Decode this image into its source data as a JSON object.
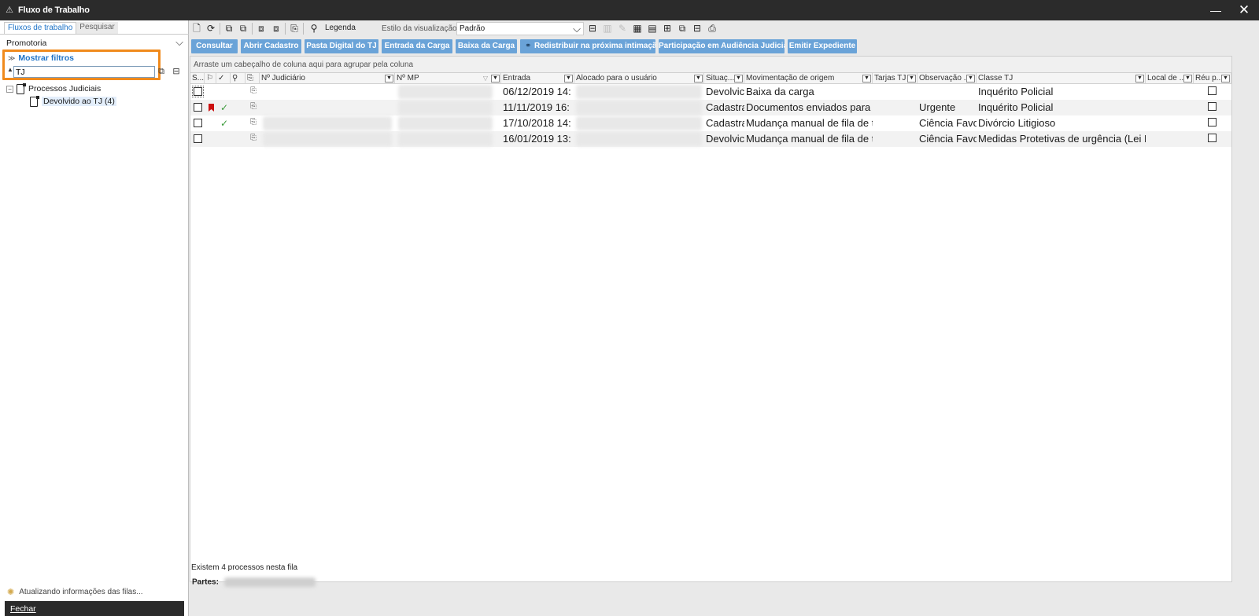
{
  "window": {
    "title": "Fluxo de Trabalho"
  },
  "left": {
    "tabs": [
      "Fluxos de trabalho",
      "Pesquisar"
    ],
    "workflow_select": "Promotoria",
    "show_filters": "Mostrar filtros",
    "filter_value": "TJ",
    "tree": {
      "root": "Processos Judiciais",
      "child": "Devolvido ao TJ (4)"
    },
    "status": "Atualizando informações das filas...",
    "close_button": "Fechar"
  },
  "toolbar": {
    "legend": "Legenda",
    "style_label": "Estilo da visualização",
    "style_value": "Padrão"
  },
  "actions": [
    "Consultar",
    "Abrir Cadastro",
    "Pasta Digital do TJ",
    "Entrada da Carga",
    "Baixa da Carga",
    "Redistribuir na próxima intimação",
    "Participação em Audiência Judicial",
    "Emitir Expediente"
  ],
  "grid": {
    "group_hint": "Arraste um cabeçalho de coluna aqui para agrupar pela coluna",
    "columns": [
      "S...",
      "Nº Judiciário",
      "Nº MP",
      "Entrada",
      "Alocado para o usuário",
      "Situaç...",
      "Movimentação de origem",
      "Tarjas TJ",
      "Observação ...",
      "Classe TJ",
      "Local de ...",
      "Réu p..."
    ],
    "rows": [
      {
        "entrada": "06/12/2019 14:",
        "situacao": "Devolvic",
        "movimentacao": "Baixa da carga",
        "observacao": "",
        "classe": "Inquérito Policial",
        "flag": false,
        "check": false
      },
      {
        "entrada": "11/11/2019 16:",
        "situacao": "Cadastra",
        "movimentacao": "Documentos enviados para a",
        "observacao": "Urgente",
        "classe": "Inquérito Policial",
        "flag": true,
        "check": true
      },
      {
        "entrada": "17/10/2018 14:",
        "situacao": "Cadastra",
        "movimentacao": "Mudança manual de fila de t",
        "observacao": "Ciência Favor",
        "classe": "Divórcio Litigioso",
        "flag": false,
        "check": true
      },
      {
        "entrada": "16/01/2019 13:",
        "situacao": "Devolvic",
        "movimentacao": "Mudança manual de fila de t",
        "observacao": "Ciência Favor",
        "classe": "Medidas Protetivas de urgência (Lei M",
        "flag": false,
        "check": false
      }
    ]
  },
  "footer": {
    "count": "Existem 4 processos nesta fila",
    "parts_label": "Partes:"
  },
  "colors": {
    "accent": "#1e73c7",
    "action_button": "#6aa3d8",
    "highlight": "#f08a1c",
    "titlebar": "#2b2b2b"
  }
}
